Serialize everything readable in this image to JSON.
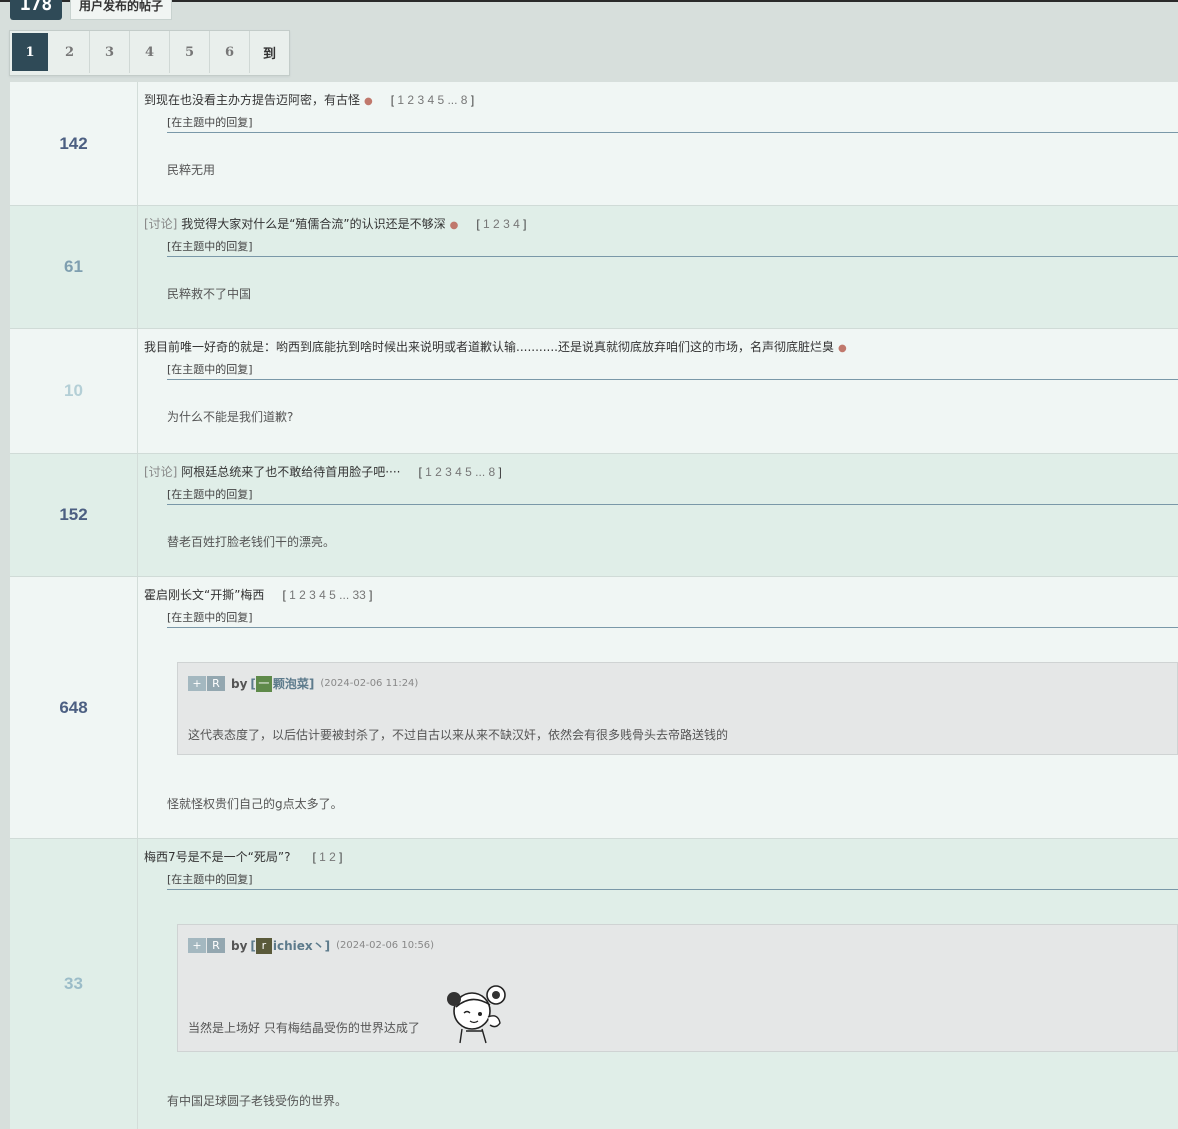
{
  "header": {
    "post_count": "178",
    "tab_title": "用户发布的帖子"
  },
  "pager": {
    "pages": [
      "1",
      "2",
      "3",
      "4",
      "5",
      "6"
    ],
    "current": "1",
    "goto_label": "到"
  },
  "reply_label": "[在主题中的回复]",
  "rows": [
    {
      "count": "142",
      "tag": "",
      "title": "到现在也没看主办方提告迈阿密，有古怪",
      "hot": "●",
      "pages": "1 2 3 4 5 ... 8",
      "reply": "民粹无用"
    },
    {
      "count": "61",
      "tag": "[讨论]",
      "title": "我觉得大家对什么是“殖儒合流”的认识还是不够深",
      "hot": "●",
      "pages": "1 2 3 4",
      "reply": "民粹救不了中国"
    },
    {
      "count": "10",
      "tag": "",
      "title": "我目前唯一好奇的就是：哟西到底能抗到啥时候出来说明或者道歉认输...........还是说真就彻底放弃咱们这的市场，名声彻底脏烂臭",
      "hot": "●",
      "pages": "",
      "reply": "为什么不能是我们道歉?"
    },
    {
      "count": "152",
      "tag": "[讨论]",
      "title": "阿根廷总统来了也不敢给待首用脸子吧····",
      "hot": "",
      "pages": "1 2 3 4 5 ... 8",
      "reply": "替老百姓打脸老钱们干的漂亮。"
    },
    {
      "count": "648",
      "tag": "",
      "title": "霍启刚长文“开撕”梅西",
      "hot": "",
      "pages": "1 2 3 4 5 ... 33",
      "quote": {
        "btn_plus": "+",
        "btn_r": "R",
        "by": "by",
        "avatar_char": "一",
        "user": "颗泡菜",
        "time": "(2024-02-06 11:24)",
        "text": "这代表态度了，以后估计要被封杀了，不过自古以来从来不缺汉奸，依然会有很多贱骨头去帝路送钱的"
      },
      "reply": "怪就怪权贵们自己的g点太多了。"
    },
    {
      "count": "33",
      "tag": "",
      "title": "梅西7号是不是一个“死局”?",
      "hot": "",
      "pages": "1 2",
      "quote": {
        "btn_plus": "+",
        "btn_r": "R",
        "by": "by",
        "avatar_char": "r",
        "user": "ichiex丶",
        "time": "(2024-02-06 10:56)",
        "text": "当然是上场好 只有梅结晶受伤的世界达成了"
      },
      "reply": "有中国足球圆子老钱受伤的世界。"
    }
  ],
  "colors": {
    "accent": "#2f4a57",
    "count_dark": "#4c5f82",
    "count_mid": "#7f9fb0",
    "count_light": "#b4cfd6",
    "hot_dot": "#c0786c",
    "avatar_green": "#5f8a4a",
    "avatar_dark": "#5a5a3a"
  }
}
